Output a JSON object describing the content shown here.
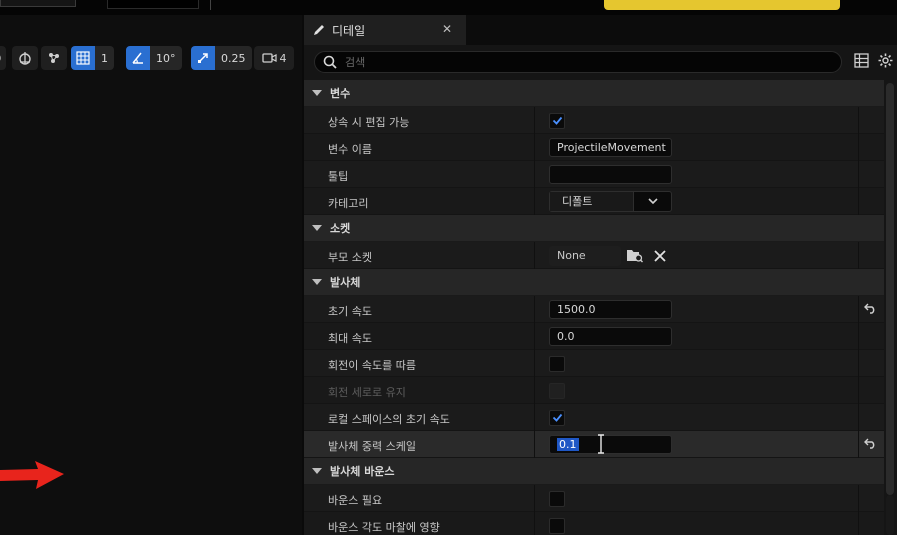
{
  "viewport_toolbar": {
    "grid_value": "1",
    "angle_value": "10°",
    "scale_value": "0.25",
    "camera_value": "4"
  },
  "details": {
    "tab_title": "디테일",
    "search_placeholder": "검색",
    "categories": {
      "variable": "변수",
      "socket": "소켓",
      "projectile": "발사체",
      "projectile_bounce": "발사체 바운스"
    },
    "props": {
      "editable_on_inherit": "상속 시 편집 가능",
      "variable_name": "변수 이름",
      "variable_name_value": "ProjectileMovement",
      "tooltip": "툴팁",
      "category": "카테고리",
      "category_value": "디폴트",
      "parent_socket": "부모 소켓",
      "parent_socket_value": "None",
      "initial_speed": "초기 속도",
      "initial_speed_value": "1500.0",
      "max_speed": "최대 속도",
      "max_speed_value": "0.0",
      "rotation_follows_velocity": "회전이 속도를 따름",
      "keep_rotation_upright": "회전 세로로 유지",
      "initial_velocity_local": "로컬 스페이스의 초기 속도",
      "gravity_scale": "발사체 중력 스케일",
      "gravity_scale_value": "0.1",
      "should_bounce": "바운스 필요",
      "bounce_angle_affects_friction": "바운스 각도 마찰에 영향"
    }
  },
  "colors": {
    "accent_blue": "#2a6fd1",
    "selection_blue": "#1f57c5",
    "yellow_button": "#e5c62f",
    "arrow_red": "#e8241c"
  }
}
